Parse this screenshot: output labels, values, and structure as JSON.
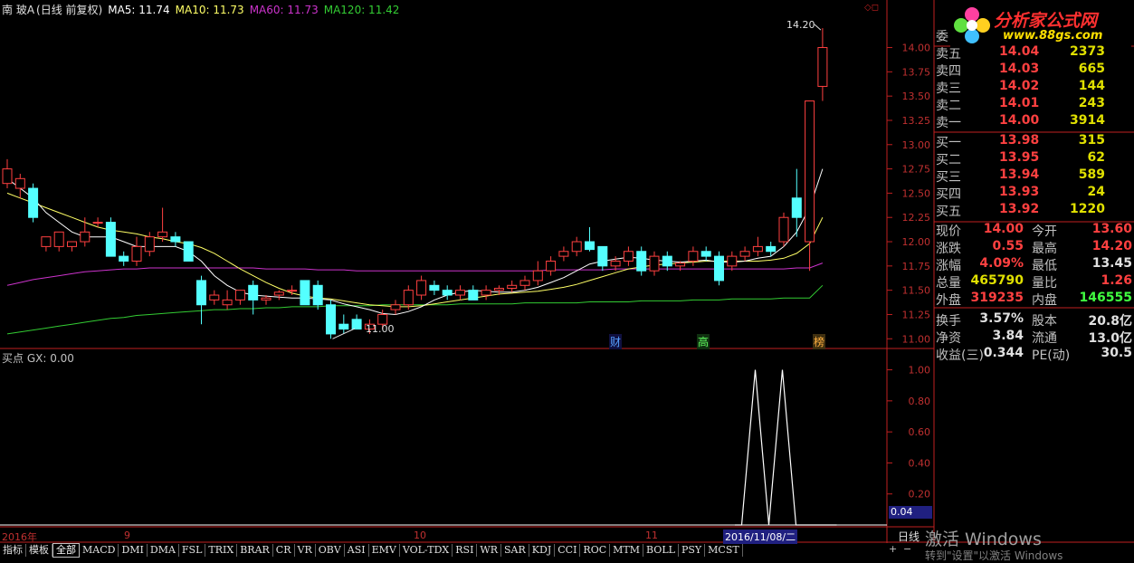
{
  "header": {
    "stock": "南 玻A",
    "mode": "(日线 前复权)",
    "ma5": "MA5: 11.74",
    "ma10": "MA10: 11.73",
    "ma60": "MA60: 11.73",
    "ma120": "MA120: 11.42"
  },
  "sub_header": "买点 GX: 0.00",
  "annotations": {
    "high_label": "14.20",
    "low_label": "11.00",
    "event_cai": "财",
    "event_gao": "高",
    "event_bang": "榜"
  },
  "price_axis_labels": [
    "14.00",
    "13.75",
    "13.50",
    "13.25",
    "13.00",
    "12.75",
    "12.50",
    "12.25",
    "12.00",
    "11.75",
    "11.50",
    "11.25",
    "11.00"
  ],
  "indicator_axis_labels": [
    "1.00",
    "0.80",
    "0.60",
    "0.40",
    "0.20"
  ],
  "indicator_current": "0.04",
  "date_axis": {
    "labels": [
      "2016年",
      "9",
      "10",
      "11"
    ],
    "highlight": "2016/11/08/二"
  },
  "logo": {
    "title": "分析家公式网",
    "url": "www.88gs.com"
  },
  "order_book": {
    "header_label": "委",
    "asks": [
      {
        "label": "卖五",
        "price": "14.04",
        "vol": "2373"
      },
      {
        "label": "卖四",
        "price": "14.03",
        "vol": "665"
      },
      {
        "label": "卖三",
        "price": "14.02",
        "vol": "144"
      },
      {
        "label": "卖二",
        "price": "14.01",
        "vol": "243"
      },
      {
        "label": "卖一",
        "price": "14.00",
        "vol": "3914"
      }
    ],
    "bids": [
      {
        "label": "买一",
        "price": "13.98",
        "vol": "315"
      },
      {
        "label": "买二",
        "price": "13.95",
        "vol": "62"
      },
      {
        "label": "买三",
        "price": "13.94",
        "vol": "589"
      },
      {
        "label": "买四",
        "price": "13.93",
        "vol": "24"
      },
      {
        "label": "买五",
        "price": "13.92",
        "vol": "1220"
      }
    ]
  },
  "quote": [
    {
      "l1": "现价",
      "v1": "14.00",
      "c1": "#ff4040",
      "l2": "今开",
      "v2": "13.60",
      "c2": "#ff4040"
    },
    {
      "l1": "涨跌",
      "v1": "0.55",
      "c1": "#ff4040",
      "l2": "最高",
      "v2": "14.20",
      "c2": "#ff4040"
    },
    {
      "l1": "涨幅",
      "v1": "4.09%",
      "c1": "#ff4040",
      "l2": "最低",
      "v2": "13.45",
      "c2": "#e0e0e0"
    },
    {
      "l1": "总量",
      "v1": "465790",
      "c1": "#e0e000",
      "l2": "量比",
      "v2": "1.26",
      "c2": "#ff4040"
    },
    {
      "l1": "外盘",
      "v1": "319235",
      "c1": "#ff4040",
      "l2": "内盘",
      "v2": "146555",
      "c2": "#40ff40"
    },
    {
      "l1": "换手",
      "v1": "3.57%",
      "c1": "#e0e0e0",
      "l2": "股本",
      "v2": "20.8亿",
      "c2": "#e0e0e0"
    },
    {
      "l1": "净资",
      "v1": "3.84",
      "c1": "#e0e0e0",
      "l2": "流通",
      "v2": "13.0亿",
      "c2": "#e0e0e0"
    },
    {
      "l1": "收益(三)",
      "v1": "0.344",
      "c1": "#e0e0e0",
      "l2": "PE(动)",
      "v2": "30.5",
      "c2": "#e0e0e0"
    }
  ],
  "tabs": [
    "指标",
    "模板",
    "全部",
    "MACD",
    "DMI",
    "DMA",
    "FSL",
    "TRIX",
    "BRAR",
    "CR",
    "VR",
    "OBV",
    "ASI",
    "EMV",
    "VOL-TDX",
    "RSI",
    "WR",
    "SAR",
    "KDJ",
    "CCI",
    "ROC",
    "MTM",
    "BOLL",
    "PSY",
    "MCST"
  ],
  "tab_active": "全部",
  "bottom_right": {
    "rixian": "日线",
    "watermark": "激活 Windows",
    "watermark2": "转到\"设置\"以激活 Windows"
  },
  "colors": {
    "up": "#ff4040",
    "down": "#54ffff",
    "ma5": "#ffffff",
    "ma10": "#ffff66",
    "ma60": "#cc33cc",
    "ma120": "#33cc33",
    "frame": "#c02020"
  },
  "chart_data": {
    "type": "candlestick",
    "title": "南 玻A (日线 前复权)",
    "ylim": [
      10.9,
      14.35
    ],
    "x_labels": [
      "2016年",
      "9",
      "10",
      "11"
    ],
    "candles": [
      {
        "o": 12.6,
        "h": 12.85,
        "l": 12.55,
        "c": 12.75
      },
      {
        "o": 12.55,
        "h": 12.7,
        "l": 12.45,
        "c": 12.65
      },
      {
        "o": 12.55,
        "h": 12.6,
        "l": 12.2,
        "c": 12.25
      },
      {
        "o": 11.95,
        "h": 12.05,
        "l": 11.9,
        "c": 12.05
      },
      {
        "o": 11.95,
        "h": 12.1,
        "l": 11.9,
        "c": 12.1
      },
      {
        "o": 11.95,
        "h": 12.0,
        "l": 11.9,
        "c": 12.0
      },
      {
        "o": 12.0,
        "h": 12.25,
        "l": 11.95,
        "c": 12.1
      },
      {
        "o": 12.2,
        "h": 12.25,
        "l": 12.15,
        "c": 12.2
      },
      {
        "o": 12.2,
        "h": 12.25,
        "l": 11.85,
        "c": 11.85
      },
      {
        "o": 11.85,
        "h": 11.9,
        "l": 11.75,
        "c": 11.8
      },
      {
        "o": 11.8,
        "h": 12.05,
        "l": 11.75,
        "c": 11.95
      },
      {
        "o": 11.9,
        "h": 12.1,
        "l": 11.85,
        "c": 12.05
      },
      {
        "o": 12.05,
        "h": 12.35,
        "l": 12.0,
        "c": 12.1
      },
      {
        "o": 12.05,
        "h": 12.1,
        "l": 11.95,
        "c": 12.0
      },
      {
        "o": 12.0,
        "h": 12.0,
        "l": 11.8,
        "c": 11.8
      },
      {
        "o": 11.6,
        "h": 11.65,
        "l": 11.15,
        "c": 11.35
      },
      {
        "o": 11.4,
        "h": 11.5,
        "l": 11.35,
        "c": 11.45
      },
      {
        "o": 11.35,
        "h": 11.5,
        "l": 11.3,
        "c": 11.4
      },
      {
        "o": 11.4,
        "h": 11.5,
        "l": 11.35,
        "c": 11.5
      },
      {
        "o": 11.55,
        "h": 11.6,
        "l": 11.25,
        "c": 11.4
      },
      {
        "o": 11.4,
        "h": 11.45,
        "l": 11.35,
        "c": 11.42
      },
      {
        "o": 11.45,
        "h": 11.5,
        "l": 11.4,
        "c": 11.48
      },
      {
        "o": 11.5,
        "h": 11.55,
        "l": 11.45,
        "c": 11.5
      },
      {
        "o": 11.6,
        "h": 11.6,
        "l": 11.35,
        "c": 11.35
      },
      {
        "o": 11.55,
        "h": 11.6,
        "l": 11.3,
        "c": 11.35
      },
      {
        "o": 11.35,
        "h": 11.4,
        "l": 11.0,
        "c": 11.05
      },
      {
        "o": 11.15,
        "h": 11.25,
        "l": 11.05,
        "c": 11.1
      },
      {
        "o": 11.2,
        "h": 11.25,
        "l": 11.1,
        "c": 11.1
      },
      {
        "o": 11.1,
        "h": 11.2,
        "l": 11.05,
        "c": 11.15
      },
      {
        "o": 11.15,
        "h": 11.3,
        "l": 11.1,
        "c": 11.25
      },
      {
        "o": 11.3,
        "h": 11.4,
        "l": 11.25,
        "c": 11.35
      },
      {
        "o": 11.35,
        "h": 11.55,
        "l": 11.3,
        "c": 11.5
      },
      {
        "o": 11.45,
        "h": 11.65,
        "l": 11.4,
        "c": 11.6
      },
      {
        "o": 11.55,
        "h": 11.6,
        "l": 11.45,
        "c": 11.5
      },
      {
        "o": 11.5,
        "h": 11.55,
        "l": 11.4,
        "c": 11.45
      },
      {
        "o": 11.45,
        "h": 11.55,
        "l": 11.4,
        "c": 11.5
      },
      {
        "o": 11.5,
        "h": 11.55,
        "l": 11.4,
        "c": 11.4
      },
      {
        "o": 11.45,
        "h": 11.55,
        "l": 11.4,
        "c": 11.5
      },
      {
        "o": 11.5,
        "h": 11.55,
        "l": 11.45,
        "c": 11.52
      },
      {
        "o": 11.52,
        "h": 11.6,
        "l": 11.48,
        "c": 11.55
      },
      {
        "o": 11.55,
        "h": 11.65,
        "l": 11.5,
        "c": 11.6
      },
      {
        "o": 11.6,
        "h": 11.8,
        "l": 11.55,
        "c": 11.7
      },
      {
        "o": 11.7,
        "h": 11.85,
        "l": 11.65,
        "c": 11.8
      },
      {
        "o": 11.85,
        "h": 11.95,
        "l": 11.8,
        "c": 11.9
      },
      {
        "o": 11.9,
        "h": 12.05,
        "l": 11.85,
        "c": 12.0
      },
      {
        "o": 12.0,
        "h": 12.15,
        "l": 11.9,
        "c": 11.92
      },
      {
        "o": 11.95,
        "h": 11.95,
        "l": 11.7,
        "c": 11.75
      },
      {
        "o": 11.75,
        "h": 11.85,
        "l": 11.7,
        "c": 11.8
      },
      {
        "o": 11.8,
        "h": 11.95,
        "l": 11.75,
        "c": 11.9
      },
      {
        "o": 11.9,
        "h": 11.95,
        "l": 11.65,
        "c": 11.7
      },
      {
        "o": 11.7,
        "h": 11.9,
        "l": 11.65,
        "c": 11.85
      },
      {
        "o": 11.85,
        "h": 11.9,
        "l": 11.7,
        "c": 11.75
      },
      {
        "o": 11.75,
        "h": 11.8,
        "l": 11.7,
        "c": 11.78
      },
      {
        "o": 11.8,
        "h": 11.95,
        "l": 11.75,
        "c": 11.9
      },
      {
        "o": 11.9,
        "h": 11.95,
        "l": 11.8,
        "c": 11.85
      },
      {
        "o": 11.85,
        "h": 11.9,
        "l": 11.55,
        "c": 11.6
      },
      {
        "o": 11.75,
        "h": 11.9,
        "l": 11.7,
        "c": 11.85
      },
      {
        "o": 11.85,
        "h": 11.95,
        "l": 11.8,
        "c": 11.9
      },
      {
        "o": 11.9,
        "h": 12.05,
        "l": 11.85,
        "c": 11.95
      },
      {
        "o": 11.95,
        "h": 12.0,
        "l": 11.85,
        "c": 11.9
      },
      {
        "o": 12.0,
        "h": 12.3,
        "l": 11.95,
        "c": 12.25
      },
      {
        "o": 12.45,
        "h": 12.75,
        "l": 12.05,
        "c": 12.25
      },
      {
        "o": 12.0,
        "h": 13.45,
        "l": 11.7,
        "c": 13.45
      },
      {
        "o": 13.6,
        "h": 14.2,
        "l": 13.45,
        "c": 14.0
      }
    ],
    "ma5": [
      12.65,
      12.55,
      12.45,
      12.3,
      12.2,
      12.1,
      12.05,
      12.05,
      12.05,
      12.0,
      11.95,
      11.95,
      11.95,
      11.95,
      11.9,
      11.8,
      11.65,
      11.55,
      11.48,
      11.45,
      11.44,
      11.43,
      11.42,
      11.42,
      11.41,
      11.4,
      11.36,
      11.33,
      11.3,
      11.26,
      11.25,
      11.28,
      11.33,
      11.4,
      11.45,
      11.48,
      11.5,
      11.49,
      11.48,
      11.48,
      11.5,
      11.53,
      11.58,
      11.63,
      11.7,
      11.77,
      11.8,
      11.82,
      11.84,
      11.83,
      11.81,
      11.8,
      11.79,
      11.8,
      11.81,
      11.79,
      11.79,
      11.8,
      11.83,
      11.85,
      11.95,
      12.1,
      12.35,
      12.75
    ],
    "ma10": [
      12.5,
      12.45,
      12.4,
      12.35,
      12.3,
      12.25,
      12.2,
      12.15,
      12.12,
      12.1,
      12.08,
      12.05,
      12.03,
      12.0,
      11.98,
      11.94,
      11.88,
      11.8,
      11.72,
      11.65,
      11.58,
      11.52,
      11.47,
      11.44,
      11.42,
      11.41,
      11.39,
      11.37,
      11.35,
      11.34,
      11.33,
      11.33,
      11.34,
      11.36,
      11.38,
      11.4,
      11.42,
      11.44,
      11.46,
      11.47,
      11.48,
      11.49,
      11.51,
      11.53,
      11.56,
      11.6,
      11.64,
      11.68,
      11.72,
      11.74,
      11.76,
      11.77,
      11.78,
      11.79,
      11.8,
      11.8,
      11.8,
      11.8,
      11.8,
      11.81,
      11.83,
      11.88,
      11.98,
      12.25
    ],
    "ma60": [
      11.55,
      11.58,
      11.61,
      11.63,
      11.65,
      11.67,
      11.69,
      11.7,
      11.71,
      11.72,
      11.72,
      11.73,
      11.73,
      11.73,
      11.73,
      11.73,
      11.73,
      11.73,
      11.73,
      11.73,
      11.72,
      11.72,
      11.72,
      11.72,
      11.71,
      11.71,
      11.71,
      11.7,
      11.7,
      11.7,
      11.7,
      11.7,
      11.7,
      11.7,
      11.7,
      11.7,
      11.7,
      11.7,
      11.7,
      11.7,
      11.7,
      11.7,
      11.71,
      11.71,
      11.71,
      11.71,
      11.71,
      11.72,
      11.72,
      11.72,
      11.72,
      11.72,
      11.72,
      11.72,
      11.72,
      11.72,
      11.72,
      11.72,
      11.72,
      11.72,
      11.72,
      11.73,
      11.73,
      11.78
    ],
    "ma120": [
      11.05,
      11.07,
      11.09,
      11.11,
      11.13,
      11.15,
      11.17,
      11.19,
      11.21,
      11.22,
      11.24,
      11.25,
      11.26,
      11.27,
      11.28,
      11.29,
      11.3,
      11.3,
      11.31,
      11.31,
      11.32,
      11.32,
      11.33,
      11.33,
      11.33,
      11.34,
      11.34,
      11.34,
      11.34,
      11.35,
      11.35,
      11.35,
      11.35,
      11.35,
      11.35,
      11.36,
      11.36,
      11.36,
      11.36,
      11.36,
      11.37,
      11.37,
      11.37,
      11.37,
      11.37,
      11.38,
      11.38,
      11.38,
      11.38,
      11.39,
      11.39,
      11.39,
      11.39,
      11.4,
      11.4,
      11.4,
      11.41,
      11.41,
      11.41,
      11.41,
      11.42,
      11.42,
      11.42,
      11.55
    ],
    "indicator": {
      "ylim": [
        0,
        1.05
      ],
      "points": [
        [
          0,
          0
        ],
        [
          48,
          0
        ],
        [
          49,
          0
        ],
        [
          51,
          1
        ],
        [
          53,
          0
        ],
        [
          55,
          1
        ],
        [
          57,
          0
        ],
        [
          63,
          0
        ]
      ]
    }
  }
}
